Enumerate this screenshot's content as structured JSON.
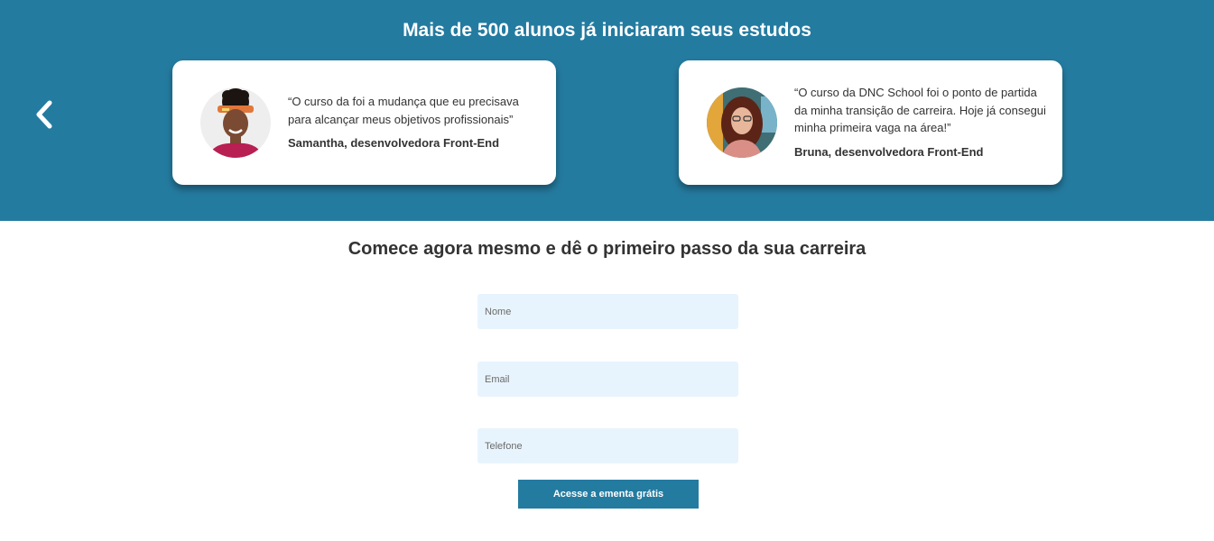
{
  "testimonials": {
    "heading": "Mais de 500 alunos já iniciaram seus estudos",
    "prev_icon": "chevron-left-icon",
    "items": [
      {
        "quote": "“O curso da foi a mudança que eu precisava para alcançar meus objetivos profissionais”",
        "author": "Samantha, desenvolvedora Front-End"
      },
      {
        "quote": "“O curso da DNC School foi o ponto de partida da minha transição de carreira. Hoje já consegui minha primeira vaga na área!”",
        "author": "Bruna, desenvolvedora Front-End"
      }
    ]
  },
  "signup": {
    "heading": "Comece agora mesmo e dê o primeiro passo da sua carreira",
    "name_placeholder": "Nome",
    "email_placeholder": "Email",
    "phone_placeholder": "Telefone",
    "submit_label": "Acesse a ementa grátis"
  },
  "colors": {
    "primary": "#247ba0",
    "input_bg": "#e8f4fd",
    "text": "#333333"
  }
}
